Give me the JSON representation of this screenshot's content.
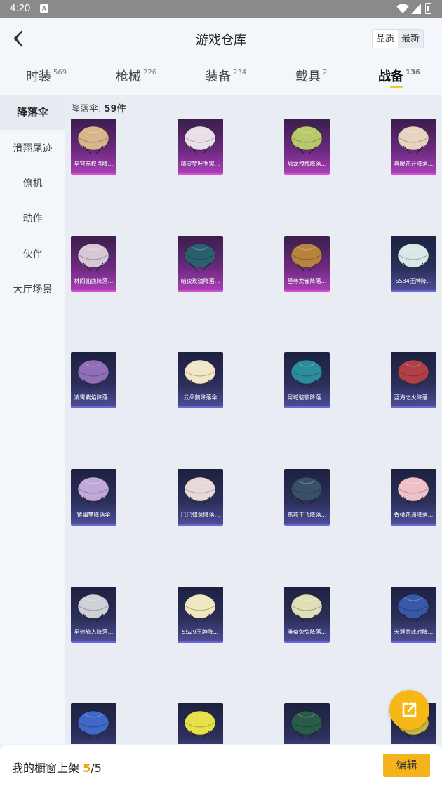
{
  "status_bar": {
    "time": "4:20",
    "badge": "A"
  },
  "header": {
    "title": "游戏仓库",
    "sort_options": [
      "品质",
      "最新"
    ],
    "active_sort": "品质"
  },
  "tabs": [
    {
      "label": "时装",
      "count": "569"
    },
    {
      "label": "枪械",
      "count": "226"
    },
    {
      "label": "装备",
      "count": "234"
    },
    {
      "label": "载具",
      "count": "2"
    },
    {
      "label": "战备",
      "count": "136",
      "active": true
    }
  ],
  "sidebar": {
    "items": [
      "降落伞",
      "滑翔尾迹",
      "僚机",
      "动作",
      "伙伴",
      "大厅场景"
    ],
    "active": "降落伞"
  },
  "main": {
    "count_prefix": "降落伞: ",
    "count_value": "59件",
    "items": [
      {
        "name": "星穹卷权肖降...",
        "rarity": "pink",
        "color": "#d9b48c"
      },
      {
        "name": "精灵梦叶罗需...",
        "rarity": "pink",
        "color": "#e9dfe9"
      },
      {
        "name": "恐龙拽拽降落...",
        "rarity": "pink",
        "color": "#b7c96a"
      },
      {
        "name": "春暖花开降落...",
        "rarity": "pink",
        "color": "#e6d4c0"
      },
      {
        "name": "林间仙鹿降落...",
        "rarity": "pink",
        "color": "#d7c8d8"
      },
      {
        "name": "暗夜玫瑰降落...",
        "rarity": "pink",
        "color": "#2a5f6e"
      },
      {
        "name": "至尊龙雀降落...",
        "rarity": "pink",
        "color": "#b8833e"
      },
      {
        "name": "SS34王牌降...",
        "rarity": "blue",
        "color": "#d8e8e8"
      },
      {
        "name": "凌霄紫焰降落...",
        "rarity": "blue",
        "color": "#8f6fb8"
      },
      {
        "name": "云朵鹅降落伞",
        "rarity": "blue",
        "color": "#f2e6c8"
      },
      {
        "name": "异域骏装降落...",
        "rarity": "blue",
        "color": "#2c8c9c"
      },
      {
        "name": "蓝海之火降落...",
        "rarity": "blue",
        "color": "#b04048"
      },
      {
        "name": "紫幽梦降落伞",
        "rarity": "blue",
        "color": "#c0a8d8"
      },
      {
        "name": "巳巳如意降落...",
        "rarity": "blue",
        "color": "#e8d8d8"
      },
      {
        "name": "燕燕于飞降落...",
        "rarity": "blue",
        "color": "#3a5068"
      },
      {
        "name": "香桃花海降落...",
        "rarity": "blue",
        "color": "#f0c0c8"
      },
      {
        "name": "星途旅人降落...",
        "rarity": "blue",
        "color": "#d0d0d8"
      },
      {
        "name": "SS29王牌降...",
        "rarity": "blue",
        "color": "#f0e8c0"
      },
      {
        "name": "雏菊兔兔降落...",
        "rarity": "blue",
        "color": "#e0e0b8"
      },
      {
        "name": "天涯共此时降...",
        "rarity": "blue",
        "color": "#3858a8"
      },
      {
        "name": "",
        "rarity": "blue",
        "color": "#4068c8"
      },
      {
        "name": "",
        "rarity": "blue",
        "color": "#e8e048"
      },
      {
        "name": "",
        "rarity": "blue",
        "color": "#2a5a48"
      },
      {
        "name": "",
        "rarity": "blue",
        "color": "#c8c040"
      }
    ]
  },
  "bottom_bar": {
    "shelf_label": "我的橱窗上架 ",
    "shelf_current": "5",
    "shelf_total": "/5",
    "edit_label": "编辑"
  },
  "colors": {
    "accent": "#f6b41c",
    "pink_rarity": "#d24fd0",
    "blue_rarity": "#6a66d8"
  }
}
